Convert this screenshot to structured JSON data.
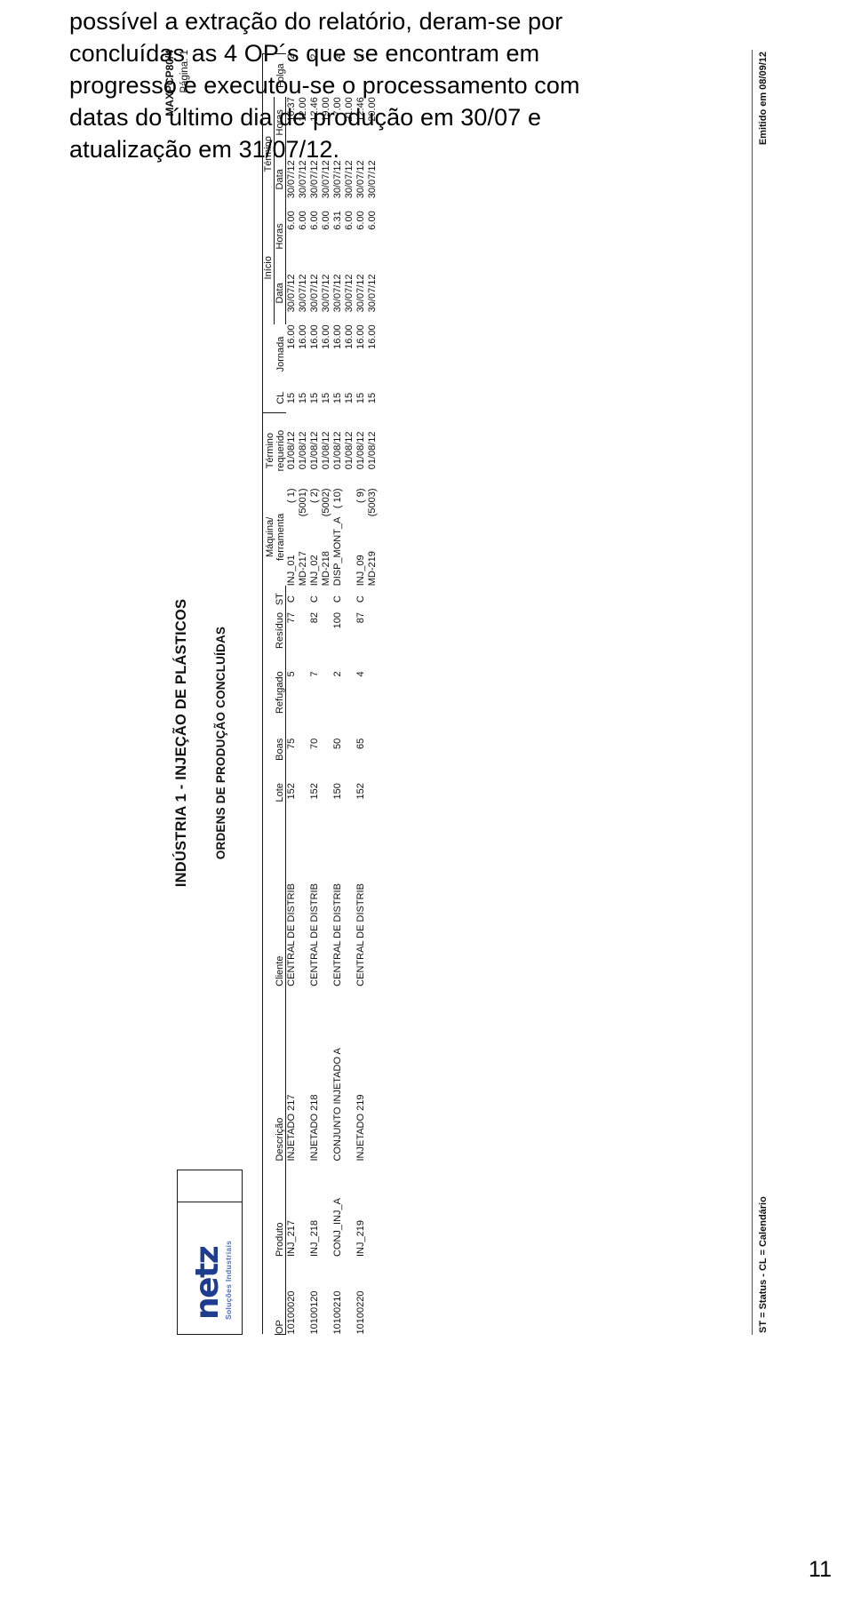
{
  "intro": {
    "lines": [
      "possível a extração do relatório, deram-se por",
      "concluídas as 4 OP´s que se encontram em",
      "progresso e executou-se o processamento com",
      "datas do último dia de produção em 30/07 e",
      "atualização em 31/07/12."
    ]
  },
  "page_number": "11",
  "report": {
    "header": {
      "system_code": "MAXPCP80/4",
      "page_label": "Página: 1",
      "logo_word": "netz",
      "logo_tagline": "Soluções Industriais",
      "title": "INDÚSTRIA 1 - INJEÇÃO DE PLÁSTICOS",
      "subtitle": "ORDENS DE PRODUÇÃO CONCLUÍDAS"
    },
    "columns": {
      "op": "OP",
      "produto": "Produto",
      "descricao": "Descrição",
      "cliente": "Cliente",
      "lote": "Lote",
      "boas": "Boas",
      "refugado": "Refugado",
      "residuo": "Resíduo",
      "st": "ST",
      "maquina_l1": "Máquina/",
      "maquina_l2": "ferramenta",
      "termino_req_l1": "Término",
      "termino_req_l2": "requerido",
      "cl": "CL",
      "jornada": "Jornada",
      "inicio_group": "Início",
      "termino_group": "Término",
      "data": "Data",
      "horas": "Horas",
      "folga": "Folga"
    },
    "rows": [
      {
        "op": "10100020",
        "produto": "INJ_217",
        "descricao": "INJETADO 217",
        "cliente": "CENTRAL DE DISTRIB",
        "lote": "152",
        "boas": "75",
        "refugado": "5",
        "residuo": "77",
        "st": "C",
        "maquina": "INJ_01",
        "maquina_num": "( 1)",
        "termino_requerido": "01/08/12",
        "cl": "15",
        "jornada": "16.00",
        "inicio_data": "30/07/12",
        "inicio_horas": "6.00",
        "termino_data": "30/07/12",
        "termino_horas": "10.37",
        "folga": "2",
        "sub_ferramenta": "MD-217",
        "sub_num": "(5001)",
        "sub_termino_requerido": "01/08/12",
        "sub_cl": "15",
        "sub_jornada": "16.00",
        "sub_inicio_data": "30/07/12",
        "sub_inicio_horas": "6.00",
        "sub_termino_data": "30/07/12",
        "sub_termino_horas": "12.00",
        "sub_folga": ""
      },
      {
        "op": "10100120",
        "produto": "INJ_218",
        "descricao": "INJETADO 218",
        "cliente": "CENTRAL DE DISTRIB",
        "lote": "152",
        "boas": "70",
        "refugado": "7",
        "residuo": "82",
        "st": "C",
        "maquina": "INJ_02",
        "maquina_num": "( 2)",
        "termino_requerido": "01/08/12",
        "cl": "15",
        "jornada": "16.00",
        "inicio_data": "30/07/12",
        "inicio_horas": "6.00",
        "termino_data": "30/07/12",
        "termino_horas": "12.46",
        "folga": "2",
        "sub_ferramenta": "MD-218",
        "sub_num": "(5002)",
        "sub_termino_requerido": "01/08/12",
        "sub_cl": "15",
        "sub_jornada": "16.00",
        "sub_inicio_data": "30/07/12",
        "sub_inicio_horas": "6.00",
        "sub_termino_data": "30/07/12",
        "sub_termino_horas": "19.00",
        "sub_folga": ""
      },
      {
        "op": "10100210",
        "produto": "CONJ_INJ_A",
        "descricao": "CONJUNTO INJETADO A",
        "cliente": "CENTRAL DE DISTRIB",
        "lote": "150",
        "boas": "50",
        "refugado": "2",
        "residuo": "100",
        "st": "C",
        "maquina": "DISP_MONT_A",
        "maquina_num": "( 10)",
        "termino_requerido": "01/08/12",
        "cl": "15",
        "jornada": "16.00",
        "inicio_data": "30/07/12",
        "inicio_horas": "6.31",
        "termino_data": "30/07/12",
        "termino_horas": "7.00",
        "folga": "2",
        "sub_ferramenta": "",
        "sub_num": "",
        "sub_termino_requerido": "01/08/12",
        "sub_cl": "15",
        "sub_jornada": "16.00",
        "sub_inicio_data": "30/07/12",
        "sub_inicio_horas": "6.00",
        "sub_termino_data": "30/07/12",
        "sub_termino_horas": "21.00",
        "sub_folga": ""
      },
      {
        "op": "10100220",
        "produto": "INJ_219",
        "descricao": "INJETADO 219",
        "cliente": "CENTRAL DE DISTRIB",
        "lote": "152",
        "boas": "65",
        "refugado": "4",
        "residuo": "87",
        "st": "C",
        "maquina": "INJ_09",
        "maquina_num": "( 9)",
        "termino_requerido": "01/08/12",
        "cl": "15",
        "jornada": "16.00",
        "inicio_data": "30/07/12",
        "inicio_horas": "6.00",
        "termino_data": "30/07/12",
        "termino_horas": "12.46",
        "folga": "2",
        "sub_ferramenta": "MD-219",
        "sub_num": "(5003)",
        "sub_termino_requerido": "01/08/12",
        "sub_cl": "15",
        "sub_jornada": "16.00",
        "sub_inicio_data": "30/07/12",
        "sub_inicio_horas": "6.00",
        "sub_termino_data": "30/07/12",
        "sub_termino_horas": "20.00",
        "sub_folga": ""
      }
    ],
    "footer": {
      "legend": "ST = Status   -   CL = Calendário",
      "emitted": "Emitido em 08/09/12"
    }
  }
}
